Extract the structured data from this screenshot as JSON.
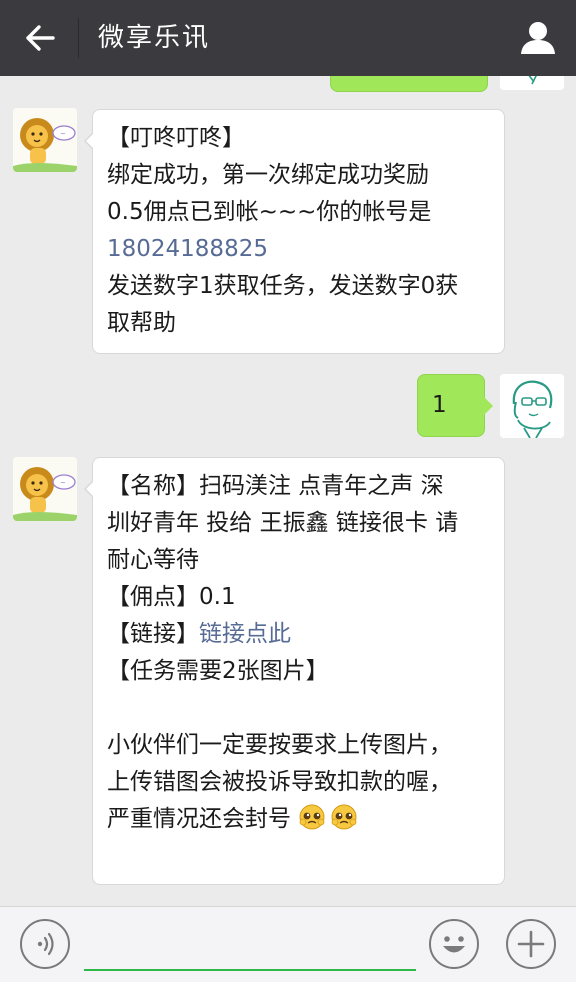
{
  "header": {
    "title": "微享乐讯"
  },
  "messages": [
    {
      "lines": [
        "【叮咚叮咚】",
        "绑定成功，第一次绑定成功奖励",
        "0.5佣点已到帐~~~你的帐号是"
      ],
      "phone": "18024188825",
      "tail": [
        "发送数字1获取任务，发送数字0获",
        "取帮助"
      ]
    },
    {
      "text": "1"
    },
    {
      "l1": "【名称】扫码渼注 点青年之声 深",
      "l2": "圳好青年 投给 王振鑫 链接很卡 请",
      "l3": "耐心等待",
      "l4": "【佣点】0.1",
      "l5_prefix": "【链接】",
      "l5_link": "链接点此",
      "l6": "【任务需要2张图片】",
      "l7": "小伙伴们一定要按要求上传图片，",
      "l8": "上传错图会被投诉导致扣款的喔，",
      "l9": "严重情况还会封号"
    }
  ],
  "colors": {
    "header_bg": "#3a3a3f",
    "link": "#576b95",
    "sent_bubble": "#a0e75a",
    "input_underline": "#2fb84a"
  },
  "icons": {
    "back": "arrow-left-icon",
    "profile": "person-icon",
    "voice": "voice-icon",
    "emoji": "smiley-icon",
    "add": "plus-icon"
  }
}
